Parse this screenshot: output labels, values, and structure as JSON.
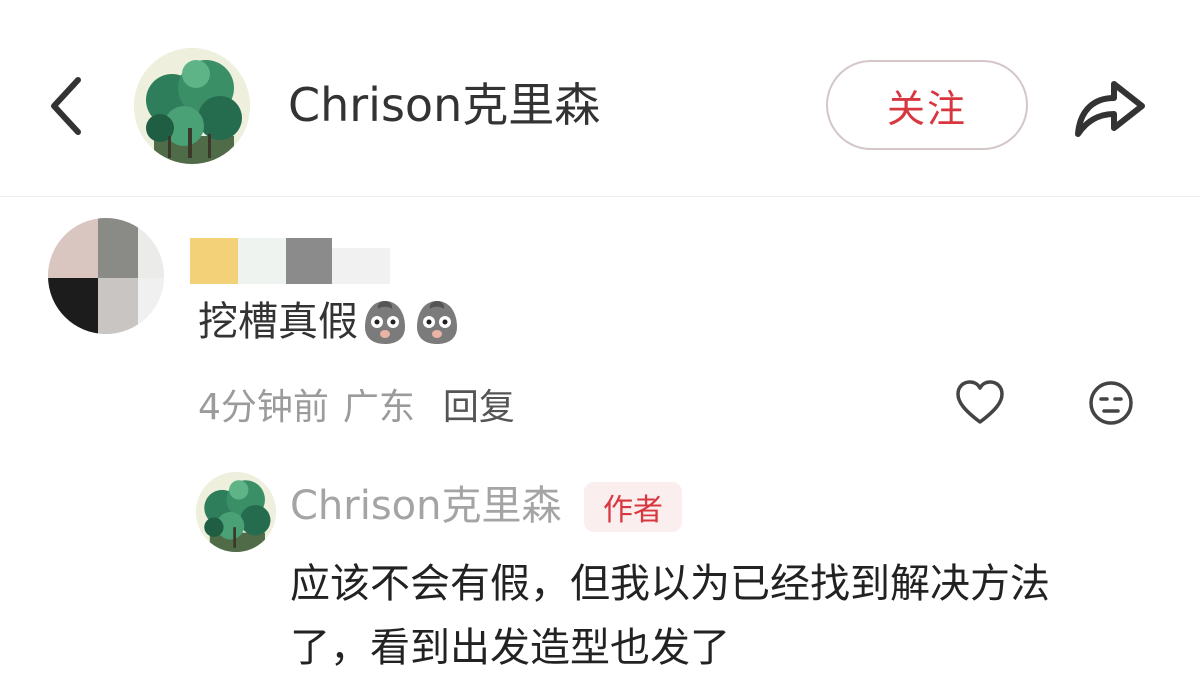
{
  "header": {
    "back_icon": "chevron-left-icon",
    "user_name": "Chrison克里森",
    "follow_label": "关注",
    "share_icon": "share-arrow-icon",
    "accent_color": "#d8373f"
  },
  "comment": {
    "text": "挖槽真假",
    "emojis": [
      "shocked-face-emoji",
      "shocked-face-emoji"
    ],
    "time": "4分钟前",
    "location": "广东",
    "reply_label": "回复",
    "like_icon": "heart-icon",
    "dislike_icon": "unamused-face-icon"
  },
  "reply": {
    "user_name": "Chrison克里森",
    "badge": "作者",
    "text": "应该不会有假，但我以为已经找到解决方法\n了，看到出发造型也发了"
  }
}
